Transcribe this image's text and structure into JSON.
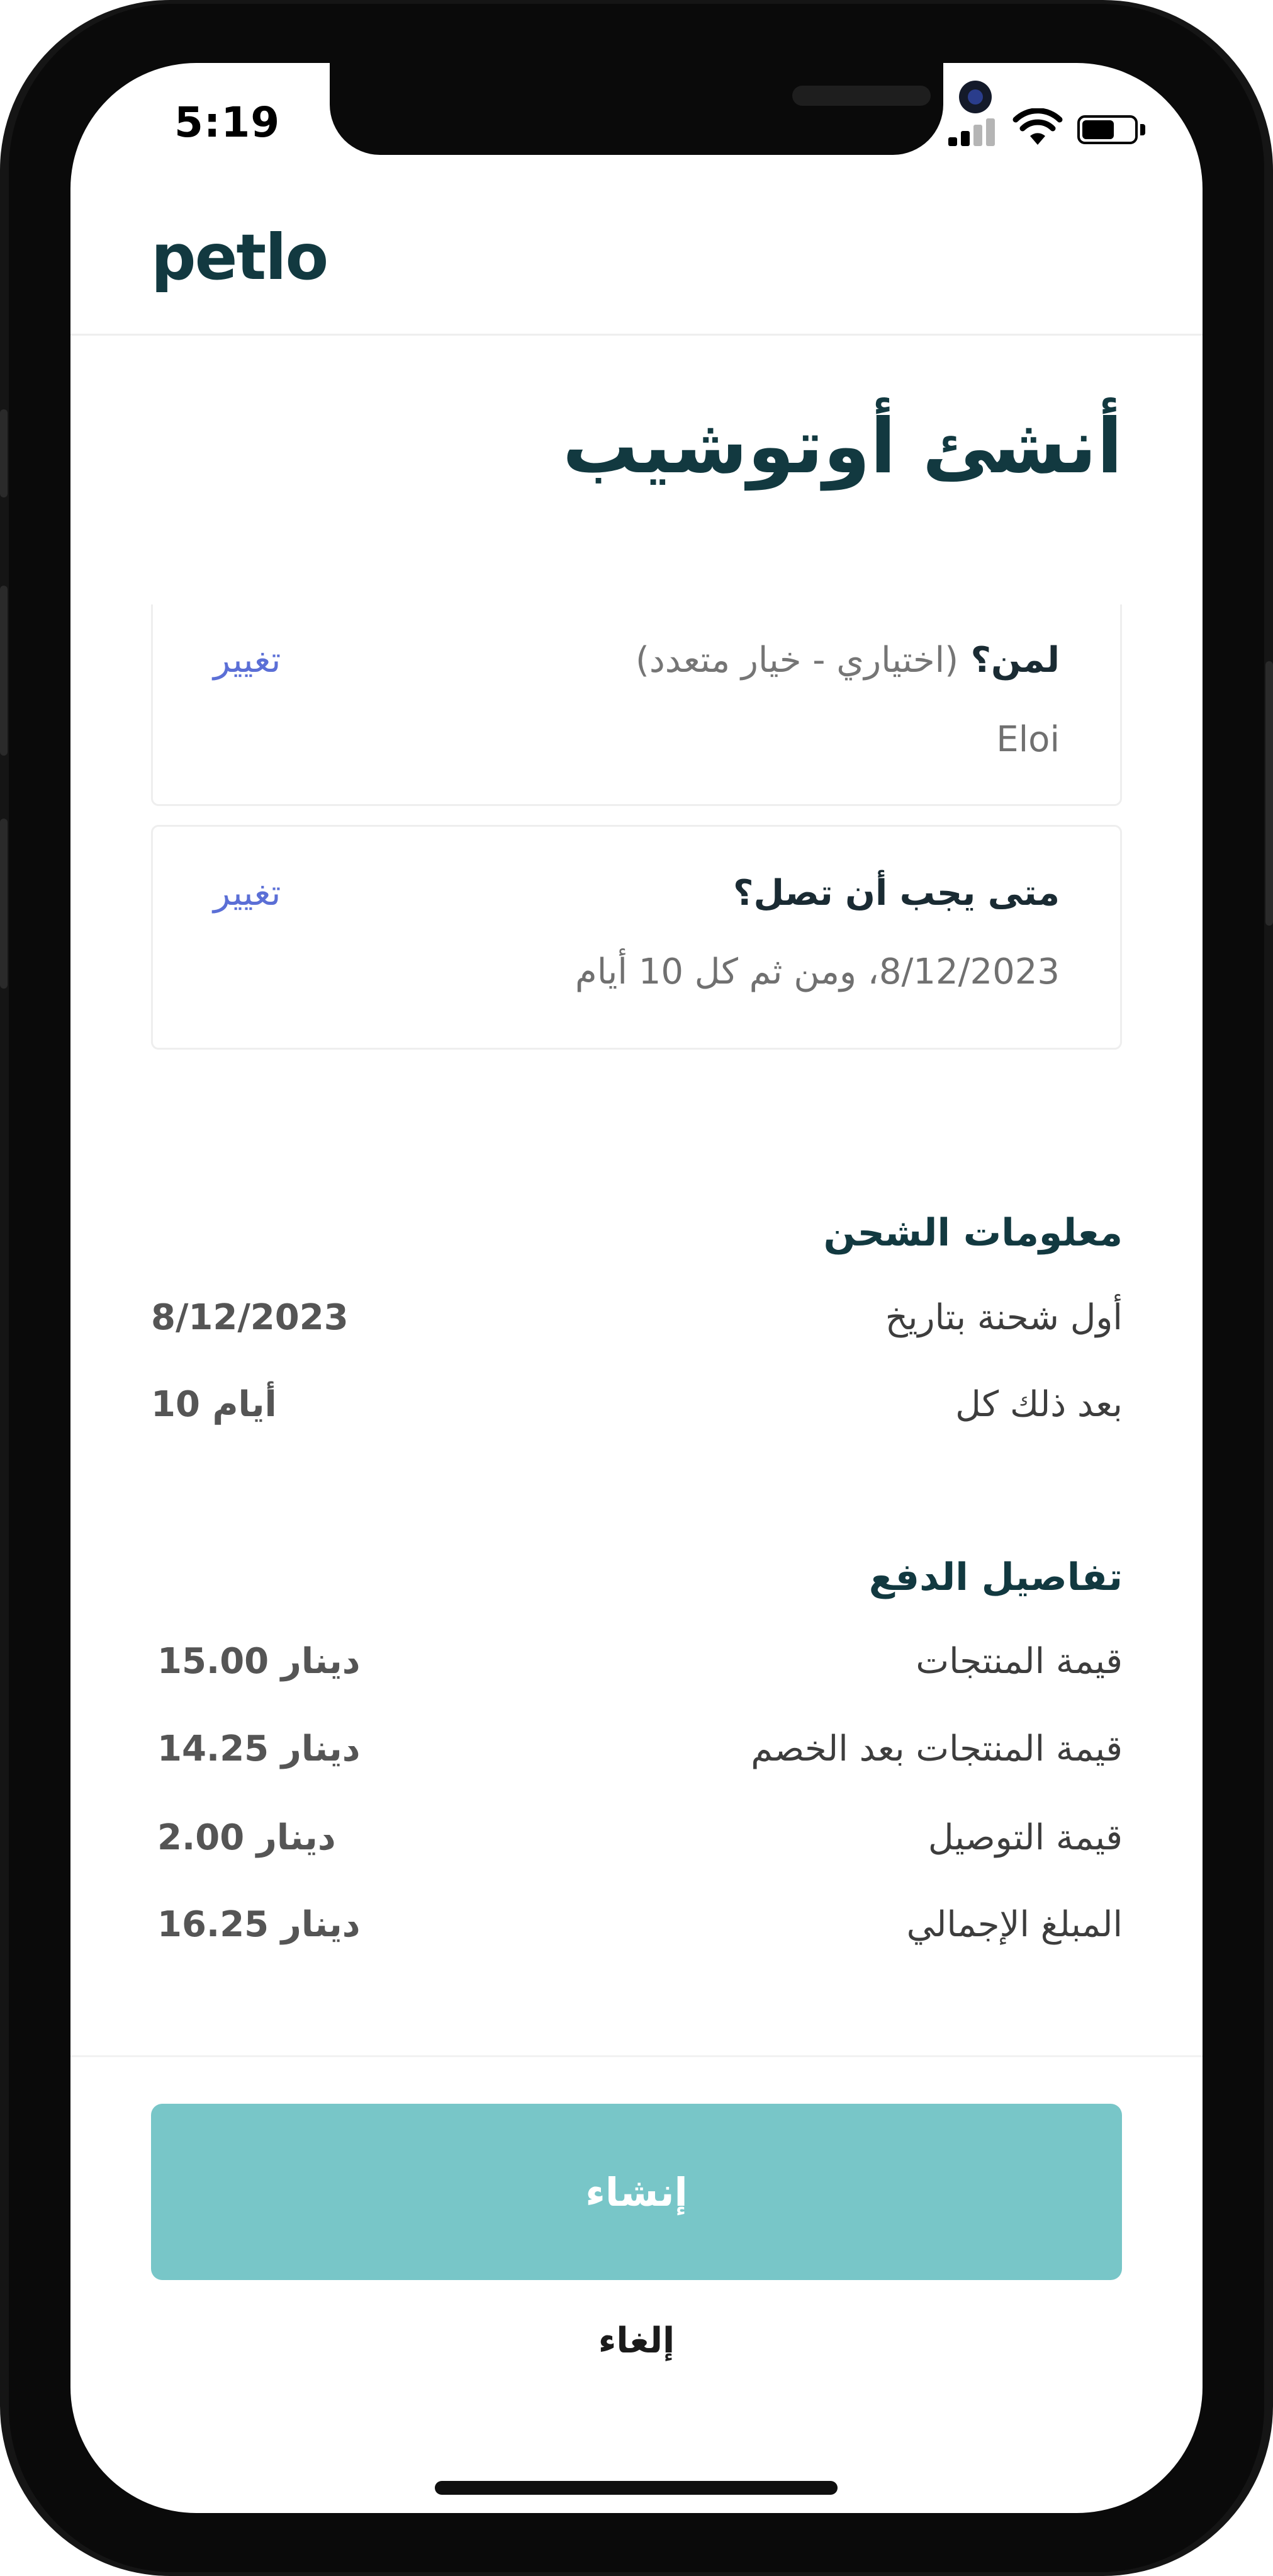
{
  "status_bar": {
    "time": "5:19"
  },
  "header": {
    "logo": "petlo"
  },
  "page": {
    "title": "أنشئ أوتوشيب"
  },
  "recipient_card": {
    "title": "لمن؟",
    "subtitle": "(اختياري - خيار متعدد)",
    "value": "Eloi",
    "change_label": "تغيير"
  },
  "delivery_card": {
    "title": "متى يجب أن تصل؟",
    "value": "8/12/2023، ومن ثم كل 10 أيام",
    "change_label": "تغيير"
  },
  "shipping_info": {
    "title": "معلومات الشحن",
    "rows": [
      {
        "label": "أول شحنة بتاريخ",
        "value": "8/12/2023"
      },
      {
        "label": "بعد ذلك كل",
        "value": "10 أيام"
      }
    ]
  },
  "payment_details": {
    "title": "تفاصيل الدفع",
    "rows": [
      {
        "label": "قيمة المنتجات",
        "value": "15.00 دينار"
      },
      {
        "label": "قيمة المنتجات بعد الخصم",
        "value": "14.25 دينار"
      },
      {
        "label": "قيمة التوصيل",
        "value": "2.00 دينار"
      },
      {
        "label": "المبلغ الإجمالي",
        "value": "16.25 دينار"
      }
    ]
  },
  "actions": {
    "create_label": "إنشاء",
    "cancel_label": "إلغاء"
  },
  "colors": {
    "brand_dark": "#123940",
    "primary_button": "#78c6c8",
    "link": "#5b6fd6"
  },
  "icons": [
    "cellular-signal-icon",
    "wifi-icon",
    "battery-icon"
  ]
}
